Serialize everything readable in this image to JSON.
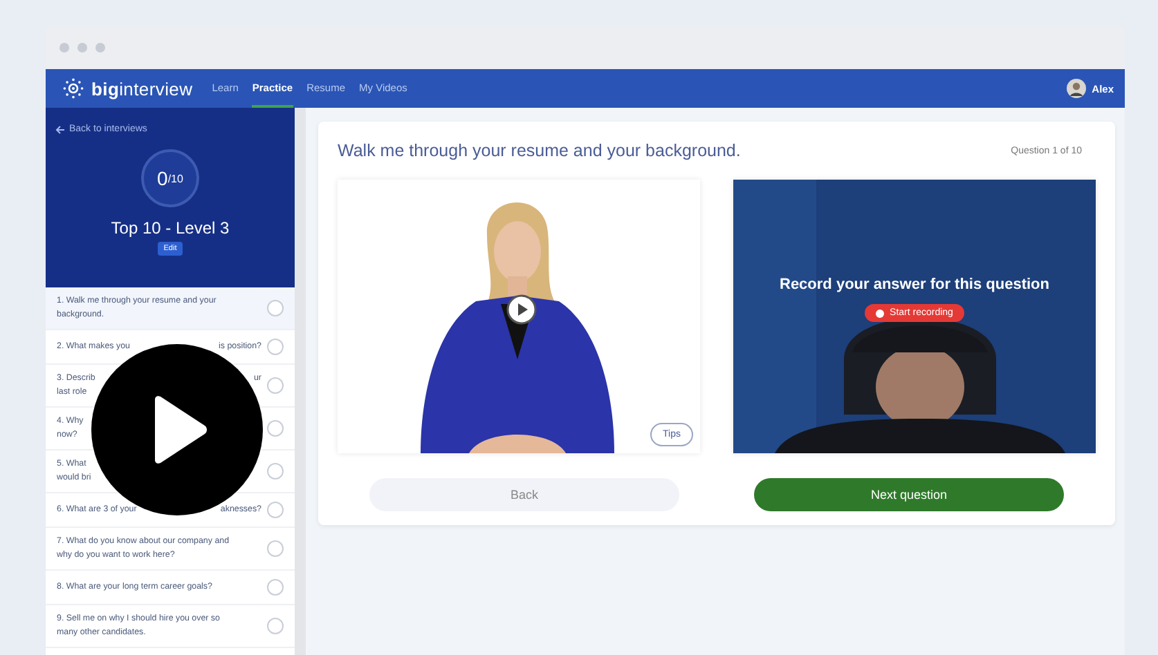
{
  "nav": {
    "logo": "**big**interview",
    "items": [
      {
        "label": "Learn",
        "selected": false
      },
      {
        "label": "Practice",
        "selected": true
      },
      {
        "label": "Resume",
        "selected": false
      },
      {
        "label": "My Videos",
        "selected": false
      }
    ],
    "user": "Alex"
  },
  "sidebar": {
    "back_link": "Back to interviews",
    "score": "0",
    "total": "/10",
    "title": "Top 10 - Level 3",
    "edit": "Edit",
    "questions": [
      {
        "selected": true,
        "checked": false,
        "lines": [
          [
            "1. Walk me through your resume and your"
          ],
          [
            "background."
          ]
        ]
      },
      {
        "selected": false,
        "checked": false,
        "lines": [
          [
            "2. What makes you",
            "is position?"
          ]
        ]
      },
      {
        "selected": false,
        "checked": false,
        "lines": [
          [
            "3. Describ",
            "ur"
          ],
          [
            "last role"
          ]
        ]
      },
      {
        "selected": false,
        "checked": false,
        "lines": [
          [
            "4. Why"
          ],
          [
            "now?"
          ]
        ]
      },
      {
        "selected": false,
        "checked": false,
        "lines": [
          [
            "5. What"
          ],
          [
            "would bri"
          ]
        ]
      },
      {
        "selected": false,
        "checked": false,
        "lines": [
          [
            "6. What are 3 of your",
            "aknesses?"
          ]
        ]
      },
      {
        "selected": false,
        "checked": false,
        "lines": [
          [
            "7. What do you know about our company and"
          ],
          [
            "why do you want to work here?"
          ]
        ]
      },
      {
        "selected": false,
        "checked": false,
        "lines": [
          [
            "8. What are your long term career goals?"
          ]
        ]
      },
      {
        "selected": false,
        "checked": false,
        "lines": [
          [
            "9. Sell me on why I should hire you over so"
          ],
          [
            "many other candidates."
          ]
        ]
      }
    ]
  },
  "main": {
    "question": "Walk me through your resume and your background.",
    "counter": "Question 1 of 10",
    "tips": "Tips",
    "record_prompt": "Record your answer for this question",
    "record_button": "Start recording",
    "back": "Back",
    "next": "Next question"
  }
}
